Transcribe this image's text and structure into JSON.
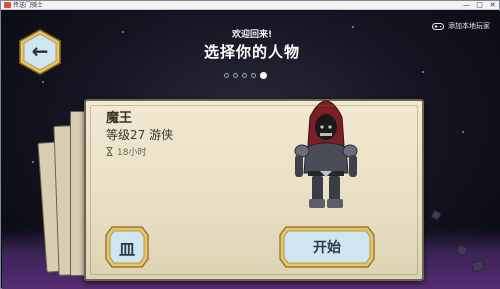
{
  "window": {
    "title": "传送门骑士",
    "minimize": "—",
    "maximize": "□",
    "close": "✕"
  },
  "header": {
    "back_icon": "arrow-left-icon",
    "welcome": "欢迎回来!",
    "title": "选择你的人物",
    "add_local_player": "添加本地玩家",
    "pager": {
      "count": 5,
      "active_index": 4
    }
  },
  "character": {
    "name": "魔王",
    "level": "等级27 游侠",
    "playtime": "18小时"
  },
  "actions": {
    "delete_icon": "trash-icon",
    "delete_glyph": "皿",
    "start_label": "开始"
  },
  "colors": {
    "accent_gold": "#e8c46a",
    "button_blue": "#cfe6f0",
    "parchment": "#ece3c8"
  }
}
